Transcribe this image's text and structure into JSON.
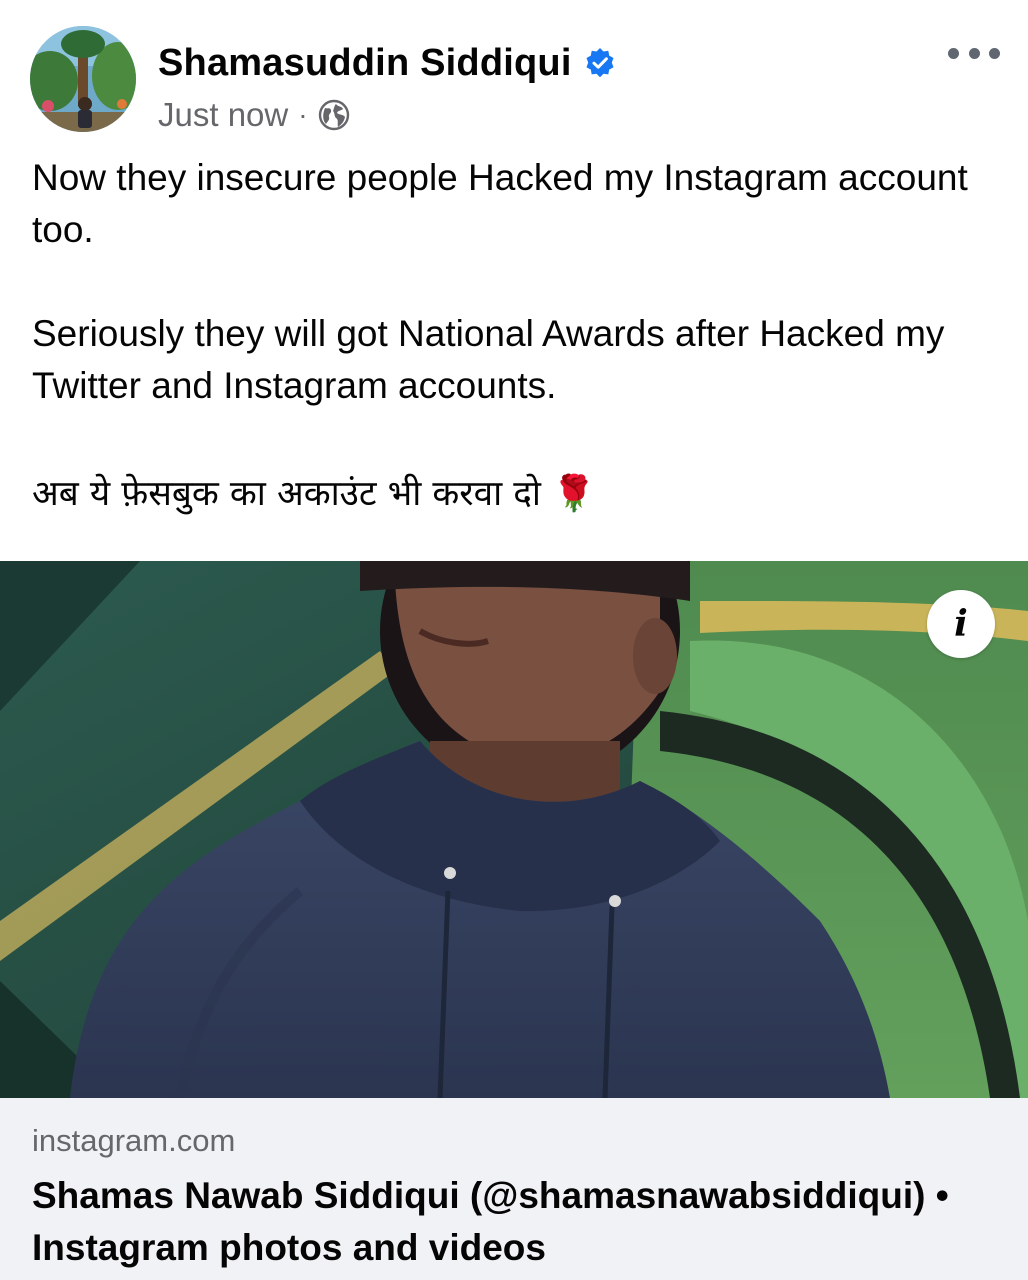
{
  "post": {
    "author_name": "Shamasuddin Siddiqui",
    "timestamp": "Just now",
    "meta_separator": "·",
    "privacy_icon": "globe-icon",
    "verified_icon": "verified-badge-icon",
    "paragraphs": [
      "Now they insecure people Hacked my Instagram account too.",
      "Seriously they will got National Awards after Hacked my Twitter and Instagram accounts.",
      "अब ये फ़ेसबुक का अकाउंट भी करवा दो 🌹"
    ]
  },
  "link_preview": {
    "info_label": "i",
    "domain": "instagram.com",
    "title": "Shamas Nawab Siddiqui (@shamasnawabsiddiqui) • Instagram photos and videos"
  },
  "colors": {
    "verified_blue": "#1877f2",
    "secondary_text": "#65676b",
    "caption_background": "#f0f2f5",
    "tent_green": "#3f6b47",
    "tent_trim": "#c9b45a",
    "hoodie": "#3b4a66"
  }
}
